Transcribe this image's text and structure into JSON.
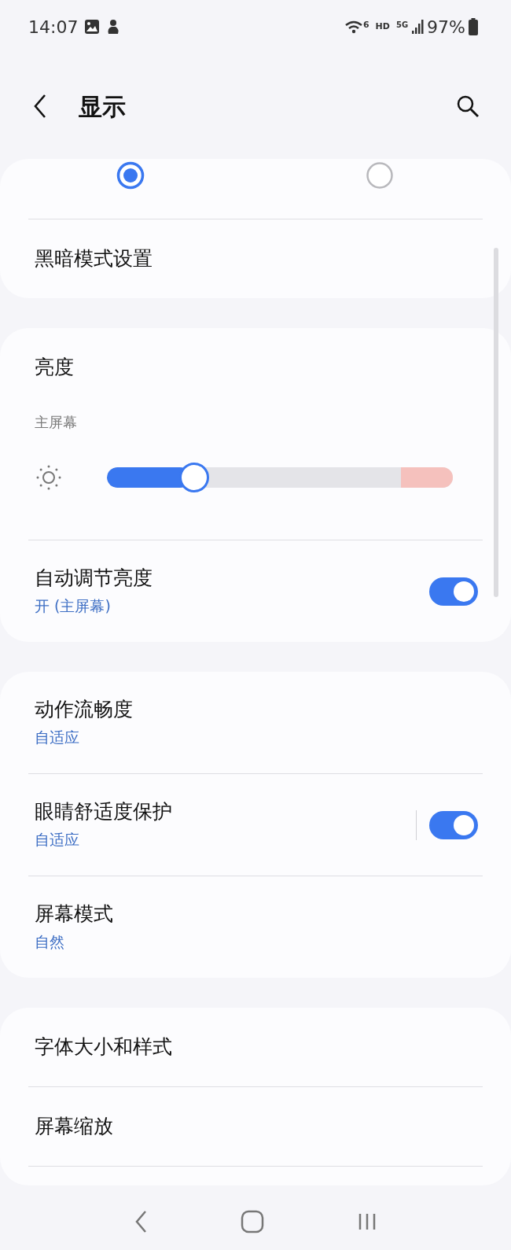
{
  "status_bar": {
    "time": "14:07",
    "wifi_tag": "6",
    "hd": "HD",
    "network": "5G",
    "battery": "97%"
  },
  "header": {
    "title": "显示"
  },
  "sections": [
    {
      "items": [
        {
          "kind": "radios",
          "options": [
            {
              "selected": true
            },
            {
              "selected": false
            }
          ]
        },
        {
          "kind": "link",
          "title": "黑暗模式设置"
        }
      ]
    },
    {
      "items": [
        {
          "kind": "heading",
          "title": "亮度"
        },
        {
          "kind": "slider",
          "label": "主屏幕",
          "level": 0.24
        },
        {
          "kind": "toggle",
          "title": "自动调节亮度",
          "subtitle": "开 (主屏幕)",
          "on": true,
          "separator": false
        }
      ]
    },
    {
      "items": [
        {
          "kind": "link",
          "title": "动作流畅度",
          "subtitle": "自适应"
        },
        {
          "kind": "toggle",
          "title": "眼睛舒适度保护",
          "subtitle": "自适应",
          "on": true,
          "separator": true
        },
        {
          "kind": "link",
          "title": "屏幕模式",
          "subtitle": "自然"
        }
      ]
    },
    {
      "items": [
        {
          "kind": "link",
          "title": "字体大小和样式"
        },
        {
          "kind": "link",
          "title": "屏幕缩放"
        },
        {
          "kind": "blank"
        }
      ]
    }
  ]
}
